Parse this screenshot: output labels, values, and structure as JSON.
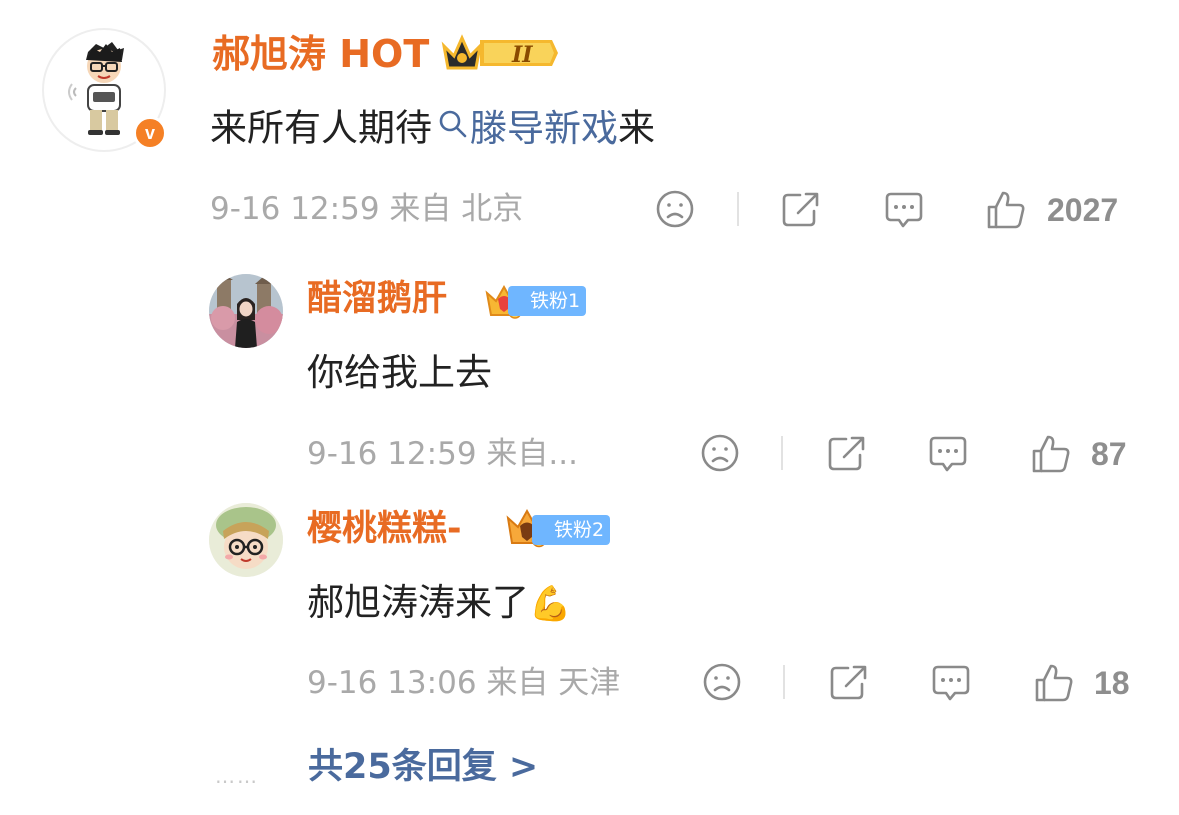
{
  "comment": {
    "author": "郝旭涛 HOT",
    "verified_label": "v",
    "level_badge": "II",
    "text_before": "来所有人期待",
    "topic": "滕导新戏",
    "text_after": "来",
    "meta": "9-16 12:59 来自 北京",
    "like_count": "2027"
  },
  "replies": [
    {
      "author": "醋溜鹅肝",
      "fan_badge": "铁粉1",
      "text": "你给我上去",
      "meta": "9-16 12:59 来自...",
      "like_count": "87"
    },
    {
      "author": "樱桃糕糕-",
      "fan_badge": "铁粉2",
      "text": "郝旭涛涛来了",
      "emoji": "💪",
      "meta": "9-16 13:06 来自 天津",
      "like_count": "18"
    }
  ],
  "more_replies": {
    "dots": "……",
    "label": "共25条回复 >"
  },
  "icons": [
    "dislike-icon",
    "share-icon",
    "comment-icon",
    "like-icon",
    "search-icon",
    "crown-icon"
  ],
  "colors": {
    "author": "#e86b23",
    "topic": "#4a6a9d",
    "meta": "#a9a9a9",
    "count": "#8e8e8e",
    "verified": "#f58025",
    "fan_badge": "#6fb6ff"
  }
}
